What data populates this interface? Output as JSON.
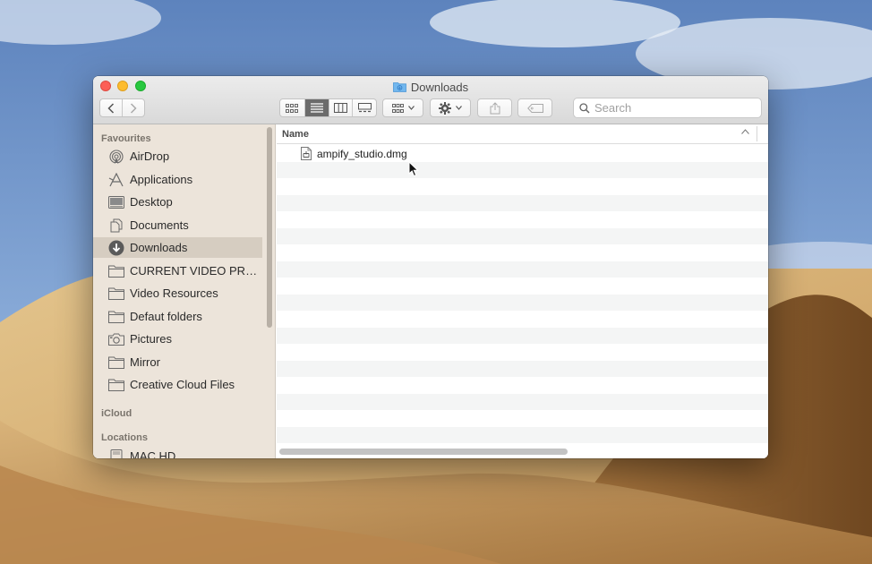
{
  "window": {
    "title": "Downloads"
  },
  "toolbar": {
    "search_placeholder": "Search"
  },
  "sidebar": {
    "sections": {
      "favourites": "Favourites",
      "icloud": "iCloud",
      "locations": "Locations"
    },
    "favourites": [
      {
        "label": "AirDrop",
        "icon": "airdrop-icon"
      },
      {
        "label": "Applications",
        "icon": "applications-icon"
      },
      {
        "label": "Desktop",
        "icon": "desktop-icon"
      },
      {
        "label": "Documents",
        "icon": "documents-icon"
      },
      {
        "label": "Downloads",
        "icon": "downloads-icon",
        "selected": true
      },
      {
        "label": "CURRENT VIDEO PRO...",
        "icon": "folder-icon"
      },
      {
        "label": "Video Resources",
        "icon": "folder-icon"
      },
      {
        "label": "Defaut folders",
        "icon": "folder-icon"
      },
      {
        "label": "Pictures",
        "icon": "camera-icon"
      },
      {
        "label": "Mirror",
        "icon": "folder-icon"
      },
      {
        "label": "Creative Cloud Files",
        "icon": "folder-icon"
      }
    ],
    "locations": [
      {
        "label": "MAC HD",
        "icon": "disk-icon"
      }
    ]
  },
  "content": {
    "columns": [
      "Name"
    ],
    "files": [
      {
        "name": "ampify_studio.dmg",
        "icon": "disk-image-icon"
      }
    ]
  },
  "colors": {
    "selected_sidebar": "#d6cdc1",
    "sidebar_bg": "#ece4da",
    "close": "#fc5f57",
    "minimize": "#fdbc2e",
    "maximize": "#28c840"
  }
}
